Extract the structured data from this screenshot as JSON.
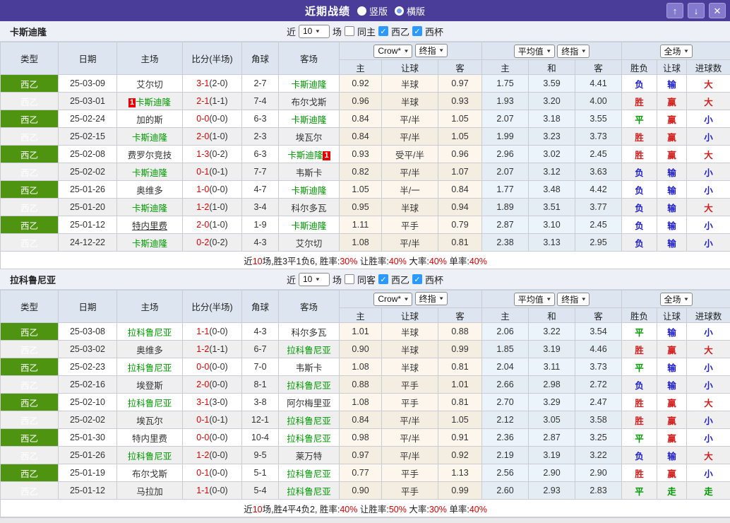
{
  "colors": {
    "purple": "#4a3d99",
    "button_purple": "#837ace",
    "green_badge": "#4e9410",
    "team_green": "#009900",
    "score_red": "#e00000",
    "checkbox_blue": "#2b99ff"
  },
  "result_colors": {
    "胜": "#d32020",
    "赢": "#d32020",
    "大": "#d32020",
    "负": "#2020cc",
    "输": "#2020cc",
    "小": "#2020cc",
    "平": "#009900",
    "走": "#009900"
  },
  "titlebar": {
    "title": "近期战绩",
    "radios": [
      {
        "label": "竖版",
        "selected": true
      },
      {
        "label": "横版",
        "selected": false
      }
    ],
    "buttons": {
      "up": "↑",
      "down": "↓",
      "close": "✕"
    }
  },
  "table_header": {
    "cols": [
      "类型",
      "日期",
      "主场",
      "比分(半场)",
      "角球",
      "客场"
    ],
    "dropdowns": {
      "group1": [
        "Crow*",
        "终指"
      ],
      "group2": [
        "平均值",
        "终指"
      ],
      "group3": [
        "全场"
      ]
    },
    "sub": [
      "主",
      "让球",
      "客",
      "主",
      "和",
      "客",
      "胜负",
      "让球",
      "进球数"
    ]
  },
  "sections": [
    {
      "team": "卡斯迪隆",
      "filter": {
        "near": "近",
        "count": "10",
        "unit": "场",
        "checkboxes": [
          {
            "label": "同主",
            "checked": false
          },
          {
            "label": "西乙",
            "checked": true
          },
          {
            "label": "西杯",
            "checked": true
          }
        ]
      },
      "rows": [
        {
          "league": "西乙",
          "date": "25-03-09",
          "home": {
            "name": "艾尔切"
          },
          "ft": "3-1",
          "ht": "(2-0)",
          "corner": "2-7",
          "away": {
            "name": "卡斯迪隆",
            "green": true
          },
          "odds": [
            "0.92",
            "半球",
            "0.97"
          ],
          "avg": [
            "1.75",
            "3.59",
            "4.41"
          ],
          "res": [
            "负",
            "输",
            "大"
          ]
        },
        {
          "league": "西乙",
          "date": "25-03-01",
          "home": {
            "name": "卡斯迪隆",
            "green": true,
            "badge": "1",
            "badge_pos": "left"
          },
          "ft": "2-1",
          "ht": "(1-1)",
          "corner": "7-4",
          "away": {
            "name": "布尔戈斯"
          },
          "odds": [
            "0.96",
            "半球",
            "0.93"
          ],
          "avg": [
            "1.93",
            "3.20",
            "4.00"
          ],
          "res": [
            "胜",
            "赢",
            "大"
          ]
        },
        {
          "league": "西乙",
          "date": "25-02-24",
          "home": {
            "name": "加的斯"
          },
          "ft": "0-0",
          "ht": "(0-0)",
          "corner": "6-3",
          "away": {
            "name": "卡斯迪隆",
            "green": true
          },
          "odds": [
            "0.84",
            "平/半",
            "1.05"
          ],
          "avg": [
            "2.07",
            "3.18",
            "3.55"
          ],
          "res": [
            "平",
            "赢",
            "小"
          ]
        },
        {
          "league": "西乙",
          "date": "25-02-15",
          "home": {
            "name": "卡斯迪隆",
            "green": true
          },
          "ft": "2-0",
          "ht": "(1-0)",
          "corner": "2-3",
          "away": {
            "name": "埃瓦尔"
          },
          "odds": [
            "0.84",
            "平/半",
            "1.05"
          ],
          "avg": [
            "1.99",
            "3.23",
            "3.73"
          ],
          "res": [
            "胜",
            "赢",
            "小"
          ]
        },
        {
          "league": "西乙",
          "date": "25-02-08",
          "home": {
            "name": "费罗尔竞技"
          },
          "ft": "1-3",
          "ht": "(0-2)",
          "corner": "6-3",
          "away": {
            "name": "卡斯迪隆",
            "green": true,
            "badge": "1",
            "badge_pos": "right"
          },
          "odds": [
            "0.93",
            "受平/半",
            "0.96"
          ],
          "avg": [
            "2.96",
            "3.02",
            "2.45"
          ],
          "res": [
            "胜",
            "赢",
            "大"
          ]
        },
        {
          "league": "西乙",
          "date": "25-02-02",
          "home": {
            "name": "卡斯迪隆",
            "green": true
          },
          "ft": "0-1",
          "ht": "(0-1)",
          "corner": "7-7",
          "away": {
            "name": "韦斯卡"
          },
          "odds": [
            "0.82",
            "平/半",
            "1.07"
          ],
          "avg": [
            "2.07",
            "3.12",
            "3.63"
          ],
          "res": [
            "负",
            "输",
            "小"
          ]
        },
        {
          "league": "西乙",
          "date": "25-01-26",
          "home": {
            "name": "奥维多"
          },
          "ft": "1-0",
          "ht": "(0-0)",
          "corner": "4-7",
          "away": {
            "name": "卡斯迪隆",
            "green": true
          },
          "odds": [
            "1.05",
            "半/一",
            "0.84"
          ],
          "avg": [
            "1.77",
            "3.48",
            "4.42"
          ],
          "res": [
            "负",
            "输",
            "小"
          ]
        },
        {
          "league": "西乙",
          "date": "25-01-20",
          "home": {
            "name": "卡斯迪隆",
            "green": true
          },
          "ft": "1-2",
          "ht": "(1-0)",
          "corner": "3-4",
          "away": {
            "name": "科尔多瓦"
          },
          "odds": [
            "0.95",
            "半球",
            "0.94"
          ],
          "avg": [
            "1.89",
            "3.51",
            "3.77"
          ],
          "res": [
            "负",
            "输",
            "大"
          ]
        },
        {
          "league": "西乙",
          "date": "25-01-12",
          "home": {
            "name": "特内里费",
            "underline": true
          },
          "ft": "2-0",
          "ht": "(1-0)",
          "corner": "1-9",
          "away": {
            "name": "卡斯迪隆",
            "green": true
          },
          "odds": [
            "1.11",
            "平手",
            "0.79"
          ],
          "avg": [
            "2.87",
            "3.10",
            "2.45"
          ],
          "res": [
            "负",
            "输",
            "小"
          ]
        },
        {
          "league": "西乙",
          "date": "24-12-22",
          "home": {
            "name": "卡斯迪隆",
            "green": true
          },
          "ft": "0-2",
          "ht": "(0-2)",
          "corner": "4-3",
          "away": {
            "name": "艾尔切"
          },
          "odds": [
            "1.08",
            "平/半",
            "0.81"
          ],
          "avg": [
            "2.38",
            "3.13",
            "2.95"
          ],
          "res": [
            "负",
            "输",
            "小"
          ]
        }
      ],
      "summary": [
        {
          "t": "近"
        },
        {
          "t": "10",
          "red": true
        },
        {
          "t": "场,胜3平1负6, 胜率:"
        },
        {
          "t": "30%",
          "red": true
        },
        {
          "t": " 让胜率:"
        },
        {
          "t": "40%",
          "red": true
        },
        {
          "t": " 大率:"
        },
        {
          "t": "40%",
          "red": true
        },
        {
          "t": " 单率:"
        },
        {
          "t": "40%",
          "red": true
        }
      ]
    },
    {
      "team": "拉科鲁尼亚",
      "filter": {
        "near": "近",
        "count": "10",
        "unit": "场",
        "checkboxes": [
          {
            "label": "同客",
            "checked": false
          },
          {
            "label": "西乙",
            "checked": true
          },
          {
            "label": "西杯",
            "checked": true
          }
        ]
      },
      "rows": [
        {
          "league": "西乙",
          "date": "25-03-08",
          "home": {
            "name": "拉科鲁尼亚",
            "green": true
          },
          "ft": "1-1",
          "ht": "(0-0)",
          "corner": "4-3",
          "away": {
            "name": "科尔多瓦"
          },
          "odds": [
            "1.01",
            "半球",
            "0.88"
          ],
          "avg": [
            "2.06",
            "3.22",
            "3.54"
          ],
          "res": [
            "平",
            "输",
            "小"
          ]
        },
        {
          "league": "西乙",
          "date": "25-03-02",
          "home": {
            "name": "奥维多"
          },
          "ft": "1-2",
          "ht": "(1-1)",
          "corner": "6-7",
          "away": {
            "name": "拉科鲁尼亚",
            "green": true
          },
          "odds": [
            "0.90",
            "半球",
            "0.99"
          ],
          "avg": [
            "1.85",
            "3.19",
            "4.46"
          ],
          "res": [
            "胜",
            "赢",
            "大"
          ]
        },
        {
          "league": "西乙",
          "date": "25-02-23",
          "home": {
            "name": "拉科鲁尼亚",
            "green": true
          },
          "ft": "0-0",
          "ht": "(0-0)",
          "corner": "7-0",
          "away": {
            "name": "韦斯卡"
          },
          "odds": [
            "1.08",
            "半球",
            "0.81"
          ],
          "avg": [
            "2.04",
            "3.11",
            "3.73"
          ],
          "res": [
            "平",
            "输",
            "小"
          ]
        },
        {
          "league": "西乙",
          "date": "25-02-16",
          "home": {
            "name": "埃登斯"
          },
          "ft": "2-0",
          "ht": "(0-0)",
          "corner": "8-1",
          "away": {
            "name": "拉科鲁尼亚",
            "green": true
          },
          "odds": [
            "0.88",
            "平手",
            "1.01"
          ],
          "avg": [
            "2.66",
            "2.98",
            "2.72"
          ],
          "res": [
            "负",
            "输",
            "小"
          ]
        },
        {
          "league": "西乙",
          "date": "25-02-10",
          "home": {
            "name": "拉科鲁尼亚",
            "green": true
          },
          "ft": "3-1",
          "ht": "(3-0)",
          "corner": "3-8",
          "away": {
            "name": "阿尔梅里亚"
          },
          "odds": [
            "1.08",
            "平手",
            "0.81"
          ],
          "avg": [
            "2.70",
            "3.29",
            "2.47"
          ],
          "res": [
            "胜",
            "赢",
            "大"
          ]
        },
        {
          "league": "西乙",
          "date": "25-02-02",
          "home": {
            "name": "埃瓦尔"
          },
          "ft": "0-1",
          "ht": "(0-1)",
          "corner": "12-1",
          "away": {
            "name": "拉科鲁尼亚",
            "green": true
          },
          "odds": [
            "0.84",
            "平/半",
            "1.05"
          ],
          "avg": [
            "2.12",
            "3.05",
            "3.58"
          ],
          "res": [
            "胜",
            "赢",
            "小"
          ]
        },
        {
          "league": "西乙",
          "date": "25-01-30",
          "home": {
            "name": "特内里费"
          },
          "ft": "0-0",
          "ht": "(0-0)",
          "corner": "10-4",
          "away": {
            "name": "拉科鲁尼亚",
            "green": true
          },
          "odds": [
            "0.98",
            "平/半",
            "0.91"
          ],
          "avg": [
            "2.36",
            "2.87",
            "3.25"
          ],
          "res": [
            "平",
            "赢",
            "小"
          ]
        },
        {
          "league": "西乙",
          "date": "25-01-26",
          "home": {
            "name": "拉科鲁尼亚",
            "green": true
          },
          "ft": "1-2",
          "ht": "(0-0)",
          "corner": "9-5",
          "away": {
            "name": "莱万特"
          },
          "odds": [
            "0.97",
            "平/半",
            "0.92"
          ],
          "avg": [
            "2.19",
            "3.19",
            "3.22"
          ],
          "res": [
            "负",
            "输",
            "大"
          ]
        },
        {
          "league": "西乙",
          "date": "25-01-19",
          "home": {
            "name": "布尔戈斯"
          },
          "ft": "0-1",
          "ht": "(0-0)",
          "corner": "5-1",
          "away": {
            "name": "拉科鲁尼亚",
            "green": true
          },
          "odds": [
            "0.77",
            "平手",
            "1.13"
          ],
          "avg": [
            "2.56",
            "2.90",
            "2.90"
          ],
          "res": [
            "胜",
            "赢",
            "小"
          ]
        },
        {
          "league": "西乙",
          "date": "25-01-12",
          "home": {
            "name": "马拉加"
          },
          "ft": "1-1",
          "ht": "(0-0)",
          "corner": "5-4",
          "away": {
            "name": "拉科鲁尼亚",
            "green": true
          },
          "odds": [
            "0.90",
            "平手",
            "0.99"
          ],
          "avg": [
            "2.60",
            "2.93",
            "2.83"
          ],
          "res": [
            "平",
            "走",
            "走"
          ]
        }
      ],
      "summary": [
        {
          "t": "近"
        },
        {
          "t": "10",
          "red": true
        },
        {
          "t": "场,胜4平4负2, 胜率:"
        },
        {
          "t": "40%",
          "red": true
        },
        {
          "t": " 让胜率:"
        },
        {
          "t": "50%",
          "red": true
        },
        {
          "t": " 大率:"
        },
        {
          "t": "30%",
          "red": true
        },
        {
          "t": " 单率:"
        },
        {
          "t": "40%",
          "red": true
        }
      ]
    }
  ]
}
